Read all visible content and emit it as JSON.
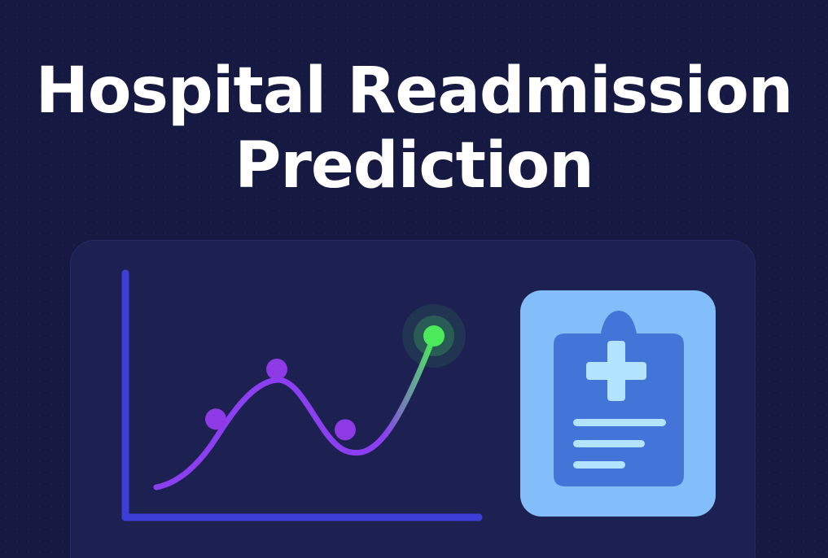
{
  "title": {
    "line1": "Hospital Readmission",
    "line2": "Prediction"
  },
  "chart_data": {
    "type": "line",
    "series": [
      {
        "values": [
          0.2,
          0.45,
          0.78,
          0.38,
          1.0
        ]
      }
    ],
    "highlight_point_index": 4,
    "grid": false
  },
  "icons": {
    "clipboard": "medical-clipboard-icon",
    "plus": "medical-plus-icon"
  },
  "colors": {
    "background": "#161a42",
    "card": "#1c2152",
    "axis": "#3d3ed8",
    "line": "#8b3ff0",
    "point": "#8e3ae6",
    "highlight": "#4aea5a",
    "clipboard_outer": "#83bdfa",
    "clipboard_inner": "#4374d8",
    "clipboard_accent": "#b3e4ff"
  }
}
